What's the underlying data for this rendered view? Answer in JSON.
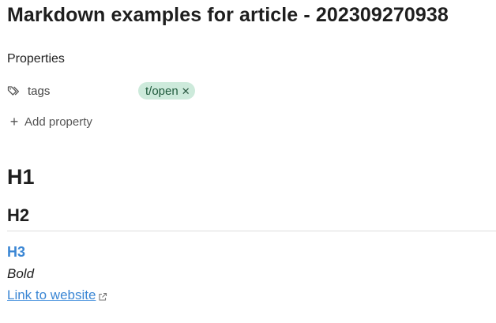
{
  "note": {
    "title": "Markdown examples for article - 202309270938"
  },
  "properties": {
    "heading": "Properties",
    "items": [
      {
        "key": "tags",
        "icon": "tags-icon",
        "values": [
          "t/open"
        ]
      }
    ],
    "add_label": "Add property"
  },
  "content": {
    "h1": "H1",
    "h2": "H2",
    "h3": "H3",
    "bold": "Bold",
    "link": "Link to website"
  },
  "colors": {
    "accent": "#3a86d4",
    "tag_bg": "#cdeadb",
    "tag_text": "#1f5a3c",
    "divider": "#dddddd"
  }
}
